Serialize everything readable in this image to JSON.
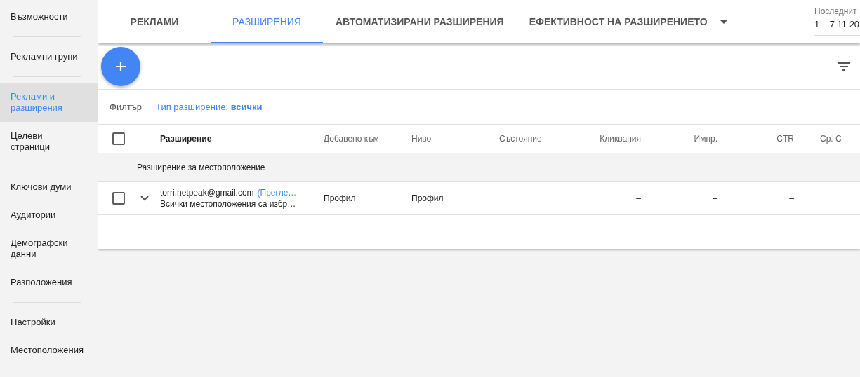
{
  "sidebar": {
    "groups": [
      [
        {
          "label": "Възможности",
          "selected": false
        }
      ],
      [
        {
          "label": "Рекламни групи",
          "selected": false
        }
      ],
      [
        {
          "label": "Реклами и разширения",
          "selected": true
        },
        {
          "label": "Целеви\nстраници",
          "selected": false
        }
      ],
      [
        {
          "label": "Ключови думи",
          "selected": false
        },
        {
          "label": "Аудитории",
          "selected": false
        },
        {
          "label": "Демографски данни",
          "selected": false
        },
        {
          "label": "Разположения",
          "selected": false
        }
      ],
      [
        {
          "label": "Настройки",
          "selected": false
        },
        {
          "label": "Местоположения",
          "selected": false
        }
      ]
    ]
  },
  "tabs": [
    {
      "label": "РЕКЛАМИ",
      "selected": false
    },
    {
      "label": "РАЗШИРЕНИЯ",
      "selected": true
    },
    {
      "label": "АВТОМАТИЗИРАНИ РАЗШИРЕНИЯ",
      "selected": false
    },
    {
      "label": "ЕФЕКТИВНОСТ НА РАЗШИРЕНИЕТО",
      "selected": false,
      "dropdown": true
    }
  ],
  "date_range": {
    "label": "Последнит",
    "value": "1 – 7 11 20"
  },
  "filter": {
    "label": "Филтър",
    "chip": "Тип разширение: **всички**"
  },
  "table": {
    "header_checked": false,
    "columns": [
      "Разширение",
      "Добавено към",
      "Ниво",
      "Състояние",
      "Кликвания",
      "Импр.",
      "CTR",
      "Ср. С"
    ],
    "group_label": "Разширение за местоположение",
    "rows": [
      {
        "checked": false,
        "cells": [
          {
            "title": "torri.netpeak@gmail.com",
            "link": "(Прегле…",
            "subtitle": "Всички местоположения са избр…"
          },
          "Профил",
          "Профил",
          "–",
          "–",
          "–",
          "–"
        ]
      }
    ]
  }
}
